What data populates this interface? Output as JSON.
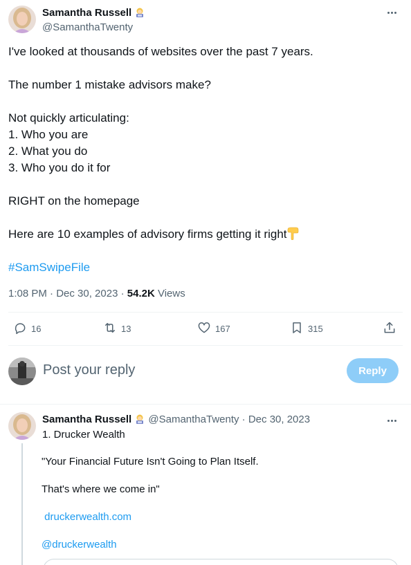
{
  "main_tweet": {
    "author_name": "Samantha Russell",
    "author_handle": "@SamanthaTwenty",
    "body": {
      "line1": "I've looked at thousands of websites over the past 7 years.",
      "line2": "The number 1 mistake advisors make?",
      "line3": "Not quickly articulating:",
      "line4": "1. Who you are",
      "line5": "2. What you do",
      "line6": "3. Who you do it for",
      "line7": "RIGHT on the homepage",
      "line8": "Here are 10 examples of advisory firms getting it right",
      "hashtag": "#SamSwipeFile"
    },
    "time": "1:08 PM · Dec 30, 2023 · ",
    "views_count": "54.2K",
    "views_label": " Views"
  },
  "actions": {
    "replies": "16",
    "retweets": "13",
    "likes": "167",
    "bookmarks": "315"
  },
  "reply_box": {
    "placeholder": "Post your reply",
    "button": "Reply"
  },
  "thread_tweet": {
    "author_name": "Samantha Russell",
    "handle_date": "@SamanthaTwenty · Dec 30, 2023",
    "line1": "1. Drucker Wealth",
    "body1": "\"Your Financial Future Isn't Going to Plan Itself.",
    "body2": "That's where we come in\"",
    "link": "druckerwealth.com",
    "mention": "@druckerwealth"
  },
  "colors": {
    "accent": "#1d9bf0",
    "reply_button": "#8ecdf8",
    "secondary_text": "#536471"
  },
  "icons": [
    "more-icon",
    "reply-icon",
    "retweet-icon",
    "like-icon",
    "bookmark-icon",
    "share-icon",
    "pointing-down-emoji",
    "woman-technologist-emoji"
  ]
}
